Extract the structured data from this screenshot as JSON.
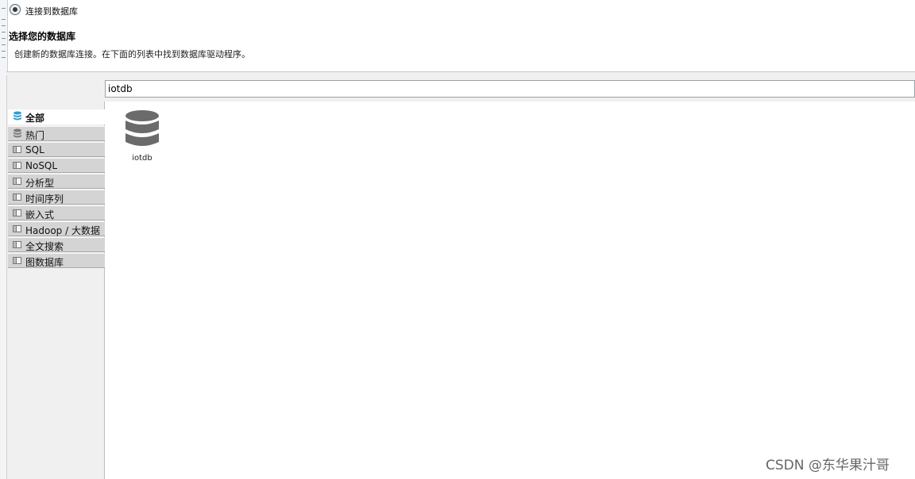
{
  "window": {
    "title": "连接到数据库"
  },
  "header": {
    "title": "选择您的数据库",
    "description": "创建新的数据库连接。在下面的列表中找到数据库驱动程序。"
  },
  "search": {
    "value": "iotdb"
  },
  "categories": [
    {
      "label": "全部",
      "active": true,
      "icon": "database-stack-icon"
    },
    {
      "label": "热门",
      "active": false,
      "icon": "database-stack-gray-icon"
    },
    {
      "label": "SQL",
      "active": false,
      "icon": "folder-icon"
    },
    {
      "label": "NoSQL",
      "active": false,
      "icon": "folder-icon"
    },
    {
      "label": "分析型",
      "active": false,
      "icon": "folder-icon"
    },
    {
      "label": "时间序列",
      "active": false,
      "icon": "folder-icon"
    },
    {
      "label": "嵌入式",
      "active": false,
      "icon": "folder-icon"
    },
    {
      "label": "Hadoop / 大数据",
      "active": false,
      "icon": "folder-icon"
    },
    {
      "label": "全文搜索",
      "active": false,
      "icon": "folder-icon"
    },
    {
      "label": "图数据库",
      "active": false,
      "icon": "folder-icon"
    }
  ],
  "drivers": [
    {
      "label": "iotdb",
      "icon": "database-icon"
    }
  ],
  "watermark": "CSDN @东华果汁哥",
  "colors": {
    "active_icon": "#2a9fd6",
    "category_bg": "#d4d4d4",
    "driver_icon": "#6b6b6b"
  }
}
